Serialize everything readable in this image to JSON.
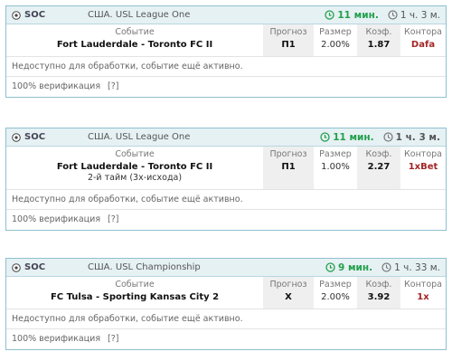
{
  "cards": [
    {
      "sport": "SOC",
      "league": "США. USL League One",
      "timer": "11 мин.",
      "duration": "1 ч. 3 м.",
      "headers": {
        "event": "Событие",
        "pick": "Прогноз",
        "size": "Размер",
        "odds": "Коэф.",
        "book": "Контора"
      },
      "event": "Fort Lauderdale - Toronto FC II",
      "event_sub": "",
      "pick": "П1",
      "size": "2.00%",
      "odds": "1.87",
      "book": "Dafa",
      "note": "Недоступно для обработки, событие ещё активно.",
      "verify": "100% верификация",
      "verify_q": "[?]"
    },
    {
      "sport": "SOC",
      "league": "США. USL League One",
      "timer": "11 мин.",
      "duration": "1 ч. 3 м.",
      "headers": {
        "event": "Событие",
        "pick": "Прогноз",
        "size": "Размер",
        "odds": "Коэф.",
        "book": "Контора"
      },
      "event": "Fort Lauderdale - Toronto FC II",
      "event_sub": "2-й тайм (3х-исхода)",
      "pick": "П1",
      "size": "1.00%",
      "odds": "2.27",
      "book": "1xBet",
      "note": "Недоступно для обработки, событие ещё активно.",
      "verify": "100% верификация",
      "verify_q": "[?]"
    },
    {
      "sport": "SOC",
      "league": "США. USL Championship",
      "timer": "9 мин.",
      "duration": "1 ч. 33 м.",
      "headers": {
        "event": "Событие",
        "pick": "Прогноз",
        "size": "Размер",
        "odds": "Коэф.",
        "book": "Контора"
      },
      "event": "FC Tulsa - Sporting Kansas City 2",
      "event_sub": "",
      "pick": "X",
      "size": "2.00%",
      "odds": "3.92",
      "book": "1x",
      "note": "Недоступно для обработки, событие ещё активно.",
      "verify": "100% верификация",
      "verify_q": "[?]"
    }
  ]
}
